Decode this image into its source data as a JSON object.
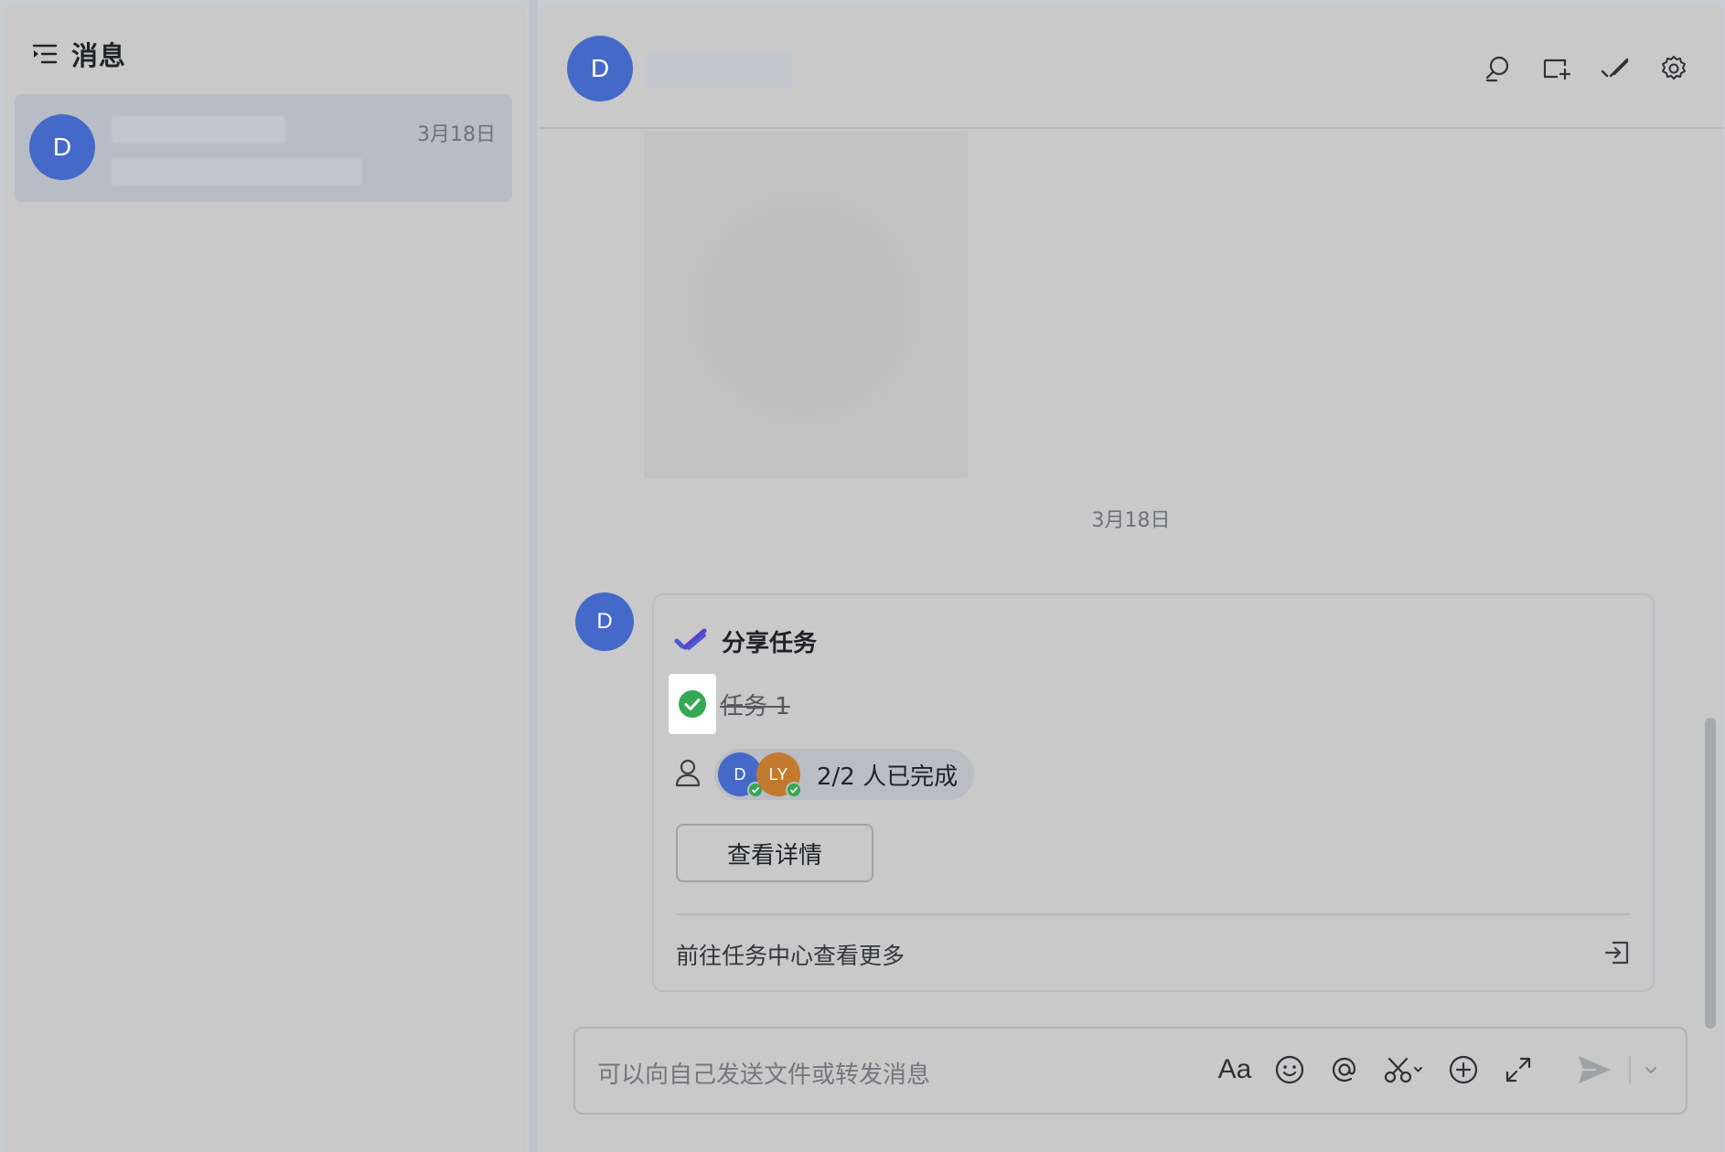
{
  "sidebar": {
    "title": "消息",
    "conversations": [
      {
        "avatar_letter": "D",
        "date": "3月18日"
      }
    ]
  },
  "chat": {
    "header_avatar_letter": "D",
    "date_separator": "3月18日",
    "message": {
      "avatar_letter": "D",
      "card": {
        "title": "分享任务",
        "task_name": "任务 1",
        "assignees": [
          {
            "initials": "D",
            "color": "#4469c8"
          },
          {
            "initials": "LY",
            "color": "#c27a2e"
          }
        ],
        "completion_text": "2/2 人已完成",
        "detail_button": "查看详情",
        "footer_link": "前往任务中心查看更多"
      }
    },
    "composer": {
      "placeholder": "可以向自己发送文件或转发消息",
      "format_label": "Aa"
    }
  },
  "colors": {
    "avatar_blue": "#4469c8",
    "task_accent": "#4b5bd6",
    "done_green": "#34a853"
  },
  "icons": {
    "header": [
      "search-icon",
      "add-tab-icon",
      "task-icon",
      "settings-icon"
    ],
    "composer": [
      "format-icon",
      "emoji-icon",
      "mention-icon",
      "screenshot-icon",
      "plus-icon",
      "expand-icon",
      "send-icon"
    ]
  }
}
